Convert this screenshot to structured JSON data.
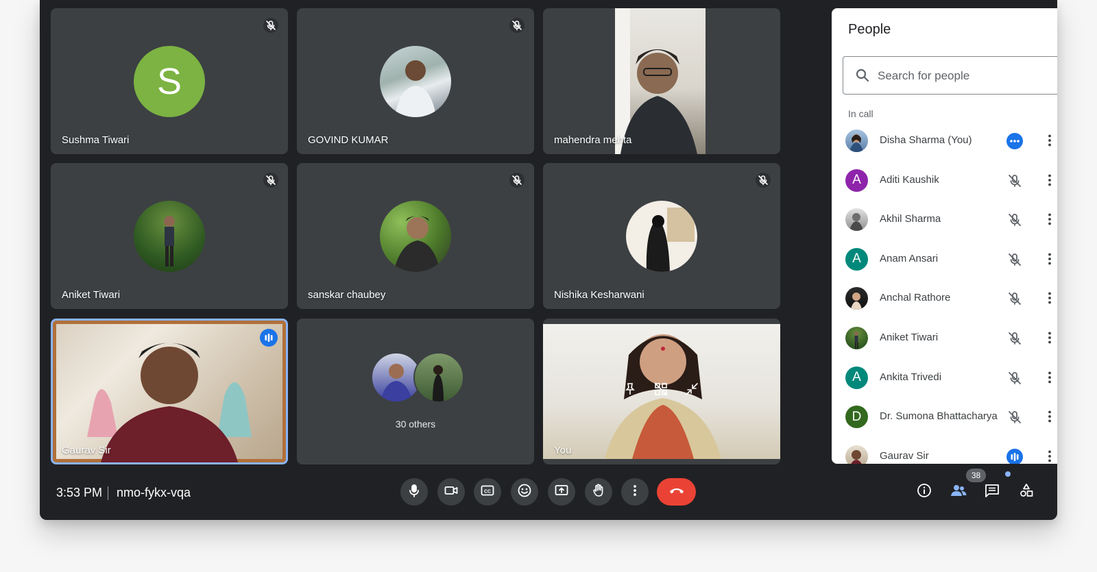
{
  "colors": {
    "background": "#202124",
    "tile": "#3c4043",
    "accent_blue": "#1a73e8",
    "end_call_red": "#ea4335",
    "avatar_green": "#7cb342",
    "avatar_purple": "#8e24aa",
    "avatar_teal": "#00897b",
    "avatar_darkgreen": "#33691e"
  },
  "tiles": [
    {
      "name": "Sushma Tiwari",
      "avatar_letter": "S",
      "muted": true
    },
    {
      "name": "GOVIND KUMAR",
      "avatar": "photo",
      "muted": true
    },
    {
      "name": "mahendra mehta",
      "video": "camera-feed",
      "muted": false
    },
    {
      "name": "Aniket Tiwari",
      "avatar": "photo",
      "muted": true
    },
    {
      "name": "sanskar chaubey",
      "avatar": "photo",
      "muted": true
    },
    {
      "name": "Nishika Kesharwani",
      "avatar": "photo",
      "muted": true
    },
    {
      "name": "Gaurav Sir",
      "video": "camera-feed",
      "speaking": true
    },
    {
      "others_label": "30 others"
    },
    {
      "name": "You",
      "video": "camera-feed"
    }
  ],
  "people_panel": {
    "title": "People",
    "search_placeholder": "Search for people",
    "section_label": "In call",
    "participants": [
      {
        "name": "Disha Sharma (You)",
        "avatar": "photo",
        "status": "options-icon"
      },
      {
        "name": "Aditi Kaushik",
        "avatar_letter": "A",
        "avatar_color": "#8e24aa",
        "status": "mic-off-icon"
      },
      {
        "name": "Akhil Sharma",
        "avatar": "photo",
        "status": "mic-off-icon"
      },
      {
        "name": "Anam Ansari",
        "avatar_letter": "A",
        "avatar_color": "#00897b",
        "status": "mic-off-icon"
      },
      {
        "name": "Anchal Rathore",
        "avatar": "photo",
        "status": "mic-off-icon"
      },
      {
        "name": "Aniket Tiwari",
        "avatar": "photo",
        "status": "mic-off-icon"
      },
      {
        "name": "Ankita Trivedi",
        "avatar_letter": "A",
        "avatar_color": "#00897b",
        "status": "mic-off-icon"
      },
      {
        "name": "Dr. Sumona Bhattacharya",
        "avatar_letter": "D",
        "avatar_color": "#33691e",
        "status": "mic-off-icon"
      },
      {
        "name": "Gaurav Sir",
        "avatar": "photo",
        "status": "speaking-icon"
      }
    ]
  },
  "bottom_bar": {
    "time": "3:53 PM",
    "meeting_code": "nmo-fykx-vqa",
    "participant_count": "38",
    "controls": [
      "mic-icon",
      "camera-icon",
      "captions-icon",
      "emoji-icon",
      "present-icon",
      "raise-hand-icon",
      "more-options-icon",
      "end-call-icon"
    ],
    "right_icons": [
      "info-icon",
      "people-icon",
      "chat-icon",
      "activities-icon"
    ]
  }
}
